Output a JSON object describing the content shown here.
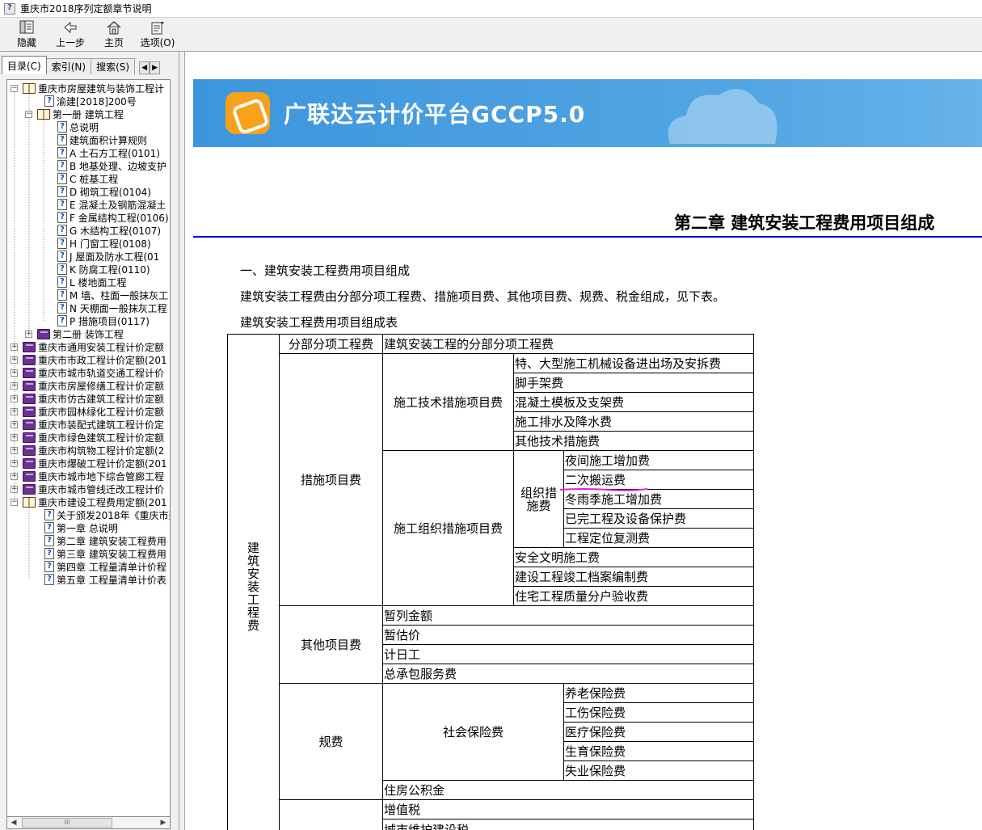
{
  "window": {
    "title": "重庆市2018序列定额章节说明"
  },
  "toolbar": {
    "hide_label": "隐藏",
    "back_label": "上一步",
    "home_label": "主页",
    "options_label": "选项(O)"
  },
  "tabs": {
    "contents": "目录(C)",
    "index": "索引(N)",
    "search": "搜索(S)"
  },
  "tree": [
    {
      "label": "重庆市房屋建筑与装饰工程计",
      "level": 0,
      "icon": "book-open",
      "expander": "−"
    },
    {
      "label": "渝建[2018]200号",
      "level": 1,
      "icon": "doc"
    },
    {
      "label": "第一册 建筑工程",
      "level": 1,
      "icon": "book-open",
      "expander": "−"
    },
    {
      "label": "总说明",
      "level": 2,
      "icon": "doc"
    },
    {
      "label": "建筑面积计算规则",
      "level": 2,
      "icon": "doc"
    },
    {
      "label": "A 土石方工程(0101)",
      "level": 2,
      "icon": "doc"
    },
    {
      "label": "B 地基处理、边坡支护",
      "level": 2,
      "icon": "doc"
    },
    {
      "label": "C 桩基工程",
      "level": 2,
      "icon": "doc"
    },
    {
      "label": "D 砌筑工程(0104)",
      "level": 2,
      "icon": "doc"
    },
    {
      "label": "E 混凝土及钢筋混凝土",
      "level": 2,
      "icon": "doc"
    },
    {
      "label": "F 金属结构工程(0106)",
      "level": 2,
      "icon": "doc"
    },
    {
      "label": "G 木结构工程(0107)",
      "level": 2,
      "icon": "doc"
    },
    {
      "label": "H 门窗工程(0108)",
      "level": 2,
      "icon": "doc"
    },
    {
      "label": "J 屋面及防水工程(01",
      "level": 2,
      "icon": "doc"
    },
    {
      "label": "K 防腐工程(0110)",
      "level": 2,
      "icon": "doc"
    },
    {
      "label": "L 楼地面工程",
      "level": 2,
      "icon": "doc"
    },
    {
      "label": "M 墙、柱面一般抹灰工",
      "level": 2,
      "icon": "doc"
    },
    {
      "label": "N 天棚面一般抹灰工程",
      "level": 2,
      "icon": "doc"
    },
    {
      "label": "P 措施项目(0117)",
      "level": 2,
      "icon": "doc"
    },
    {
      "label": "第二册 装饰工程",
      "level": 1,
      "icon": "book-closed",
      "expander": "+"
    },
    {
      "label": "重庆市通用安装工程计价定额",
      "level": 0,
      "icon": "book-closed",
      "expander": "+"
    },
    {
      "label": "重庆市市政工程计价定额(201",
      "level": 0,
      "icon": "book-closed",
      "expander": "+"
    },
    {
      "label": "重庆市城市轨道交通工程计价",
      "level": 0,
      "icon": "book-closed",
      "expander": "+"
    },
    {
      "label": "重庆市房屋修缮工程计价定额",
      "level": 0,
      "icon": "book-closed",
      "expander": "+"
    },
    {
      "label": "重庆市仿古建筑工程计价定额",
      "level": 0,
      "icon": "book-closed",
      "expander": "+"
    },
    {
      "label": "重庆市园林绿化工程计价定额",
      "level": 0,
      "icon": "book-closed",
      "expander": "+"
    },
    {
      "label": "重庆市装配式建筑工程计价定",
      "level": 0,
      "icon": "book-closed",
      "expander": "+"
    },
    {
      "label": "重庆市绿色建筑工程计价定额",
      "level": 0,
      "icon": "book-closed",
      "expander": "+"
    },
    {
      "label": "重庆市构筑物工程计价定额(2",
      "level": 0,
      "icon": "book-closed",
      "expander": "+"
    },
    {
      "label": "重庆市爆破工程计价定额(201",
      "level": 0,
      "icon": "book-closed",
      "expander": "+"
    },
    {
      "label": "重庆市城市地下综合管廊工程",
      "level": 0,
      "icon": "book-closed",
      "expander": "+"
    },
    {
      "label": "重庆市城市管线迁改工程计价",
      "level": 0,
      "icon": "book-closed",
      "expander": "+"
    },
    {
      "label": "重庆市建设工程费用定额(201",
      "level": 0,
      "icon": "book-open",
      "expander": "−"
    },
    {
      "label": "关于颁发2018年《重庆市建",
      "level": 1,
      "icon": "doc"
    },
    {
      "label": "第一章 总说明",
      "level": 1,
      "icon": "doc"
    },
    {
      "label": "第二章 建筑安装工程费用",
      "level": 1,
      "icon": "doc"
    },
    {
      "label": "第三章 建筑安装工程费用",
      "level": 1,
      "icon": "doc"
    },
    {
      "label": "第四章 工程量清单计价程",
      "level": 1,
      "icon": "doc"
    },
    {
      "label": "第五章 工程量清单计价表",
      "level": 1,
      "icon": "doc"
    }
  ],
  "scrollbar": {
    "grip": "III"
  },
  "banner": {
    "brand": "广联达云计价平台GCCP5.0"
  },
  "document": {
    "chapter_title": "第二章  建筑安装工程费用项目组成",
    "section_heading": "一、建筑安装工程费用项目组成",
    "intro": "建筑安装工程费由分部分项工程费、措施项目费、其他项目费、规费、税金组成，见下表。",
    "table_caption": "建筑安装工程费用项目组成表"
  },
  "table": {
    "root": "建筑安装工程费",
    "fenbu": "分部分项工程费",
    "fenbu_desc": "建筑安装工程的分部分项工程费",
    "cuoshi": "措施项目费",
    "tech": "施工技术措施项目费",
    "tech_items": [
      "特、大型施工机械设备进出场及安拆费",
      "脚手架费",
      "混凝土模板及支架费",
      "施工排水及降水费",
      "其他技术措施费"
    ],
    "org": "施工组织措施项目费",
    "zuzhi": "组织措施费",
    "zuzhi_items": [
      "夜间施工增加费",
      "二次搬运费",
      "冬雨季施工增加费",
      "已完工程及设备保护费",
      "工程定位复测费"
    ],
    "org_items": [
      "安全文明施工费",
      "建设工程竣工档案编制费",
      "住宅工程质量分户验收费"
    ],
    "qita": "其他项目费",
    "qita_items": [
      "暂列金额",
      "暂估价",
      "计日工",
      "总承包服务费"
    ],
    "guifei": "规费",
    "shebao": "社会保险费",
    "shebao_items": [
      "养老保险费",
      "工伤保险费",
      "医疗保险费",
      "生育保险费",
      "失业保险费"
    ],
    "gongjijin": "住房公积金",
    "shuijin_items": [
      "增值税",
      "城市维护建设税"
    ]
  },
  "colors": {
    "banner_blue": "#3d95dc",
    "rule_blue": "#0000cc",
    "highlight_pen": "#e020e0",
    "logo_orange": "#f7a21b"
  }
}
